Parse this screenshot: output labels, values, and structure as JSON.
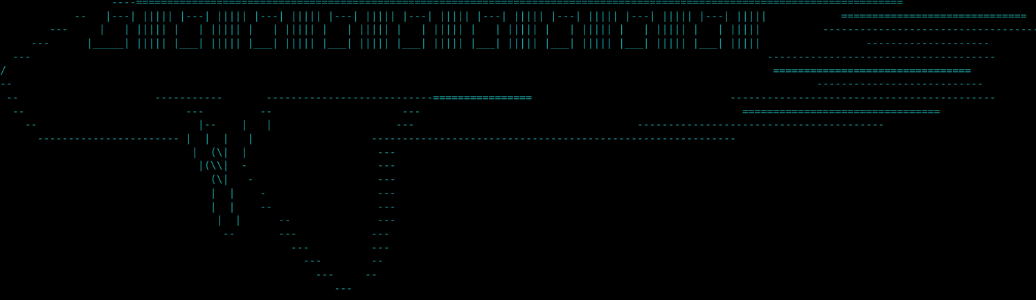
{
  "colors": {
    "background": "#000000",
    "foreground": "#1a9a9a"
  },
  "terminal": {
    "lines": [
      "                  ----============================================================================================================================",
      "            --   |---| ||||| |---| ||||| |---| ||||| |---| ||||| |---| ||||| |---| ||||| |---| ||||| |---| ||||| |---| |||||            ==============================",
      "        ---     |   | ||||| |   | ||||| |   | ||||| |   | ||||| |   | ||||| |   | ||||| |   | ||||| |   | ||||| |   | |||||          -----------------------------------------",
      "     ---      |_____| ||||| |___| ||||| |___| ||||| |___| ||||| |___| ||||| |___| ||||| |___| ||||| |___| ||||| |___| |||||                 --------------------",
      "  ---                                                                                                                       -------------------------------------",
      "/                                                                                                                            ================================",
      "--                                                                                                                                  ---------------------------",
      " --                      -----------       ---------------------------================                                -------------------------------------------",
      "  --                          ---         --                     ---                                                    ================================",
      "    --                          |--    |   |                    ---                                    ----------------------------------------",
      "      ----------------------- |  |  |   |                   -----------------------------------------------------------",
      "                               |  (\\|  |                     ---",
      "                                |(\\\\|  -                     ---",
      "                                  (\\|   -                    ---",
      "                                  |  |    -                  ---",
      "                                  |  |    --                 ---",
      "                                   |  |      --              ---",
      "                                    --       ---            ---",
      "                                               ---          ---",
      "                                                 ---        --",
      "                                                   ---     --",
      "                                                      ---"
    ]
  }
}
